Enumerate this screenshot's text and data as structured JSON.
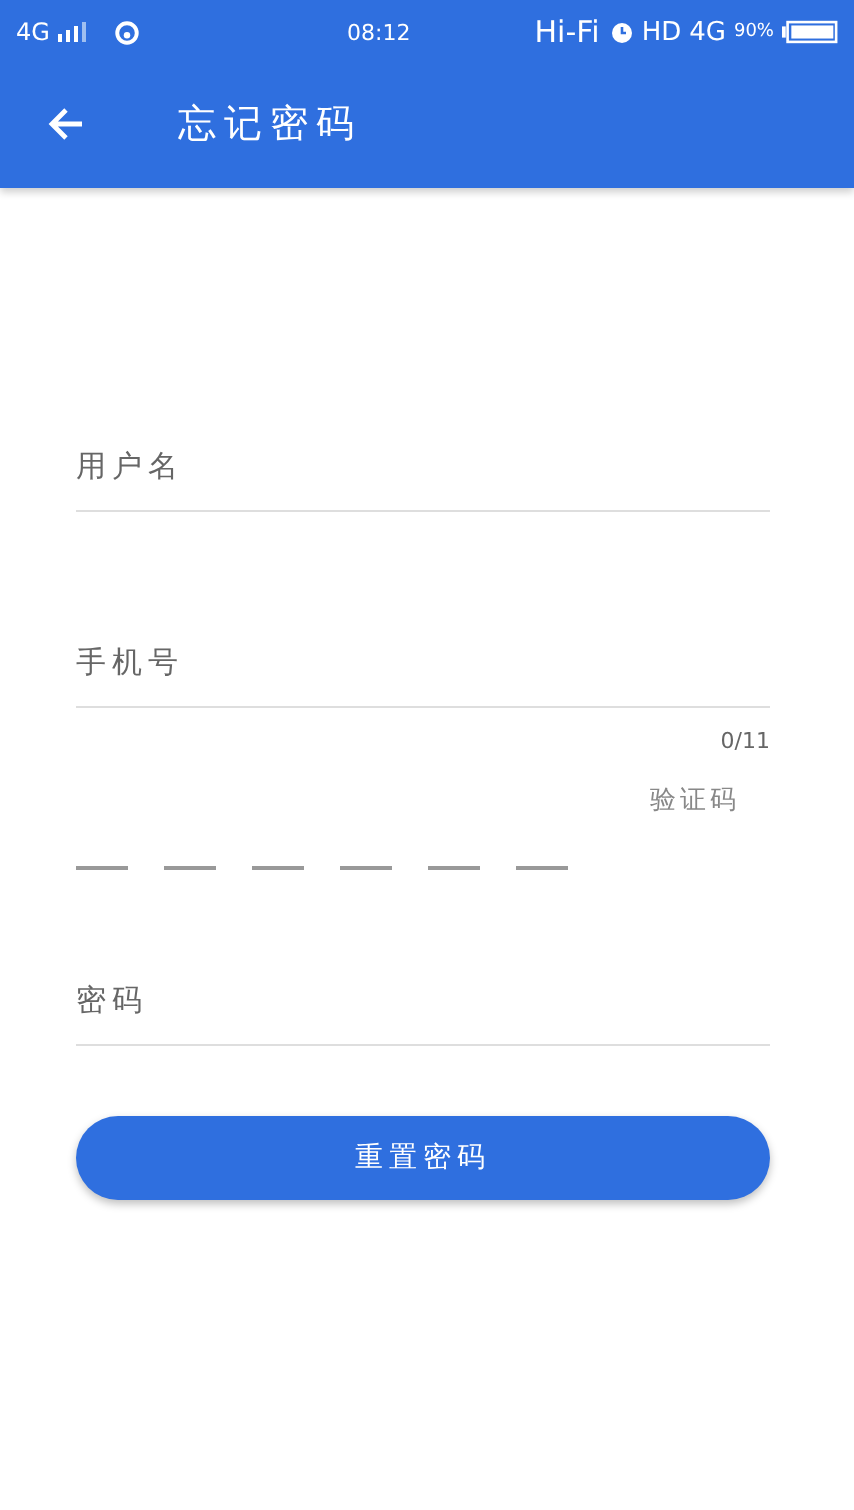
{
  "status_bar": {
    "network": "4G",
    "time": "08:12",
    "hifi": "Hi-Fi",
    "hd": "HD",
    "network_right": "4G",
    "battery": "90%"
  },
  "header": {
    "title": "忘记密码"
  },
  "fields": [
    {
      "placeholder": "用户名"
    },
    {
      "placeholder": "手机号",
      "counter": "0/11"
    }
  ],
  "code": {
    "slots": [
      {
        "filled": false
      },
      {
        "filled": false
      },
      {
        "filled": false
      },
      {
        "filled": false
      },
      {
        "filled": false
      },
      {
        "filled": false
      }
    ],
    "button": "验证码"
  },
  "password": {
    "placeholder": "密码"
  },
  "submit": "重置密码"
}
